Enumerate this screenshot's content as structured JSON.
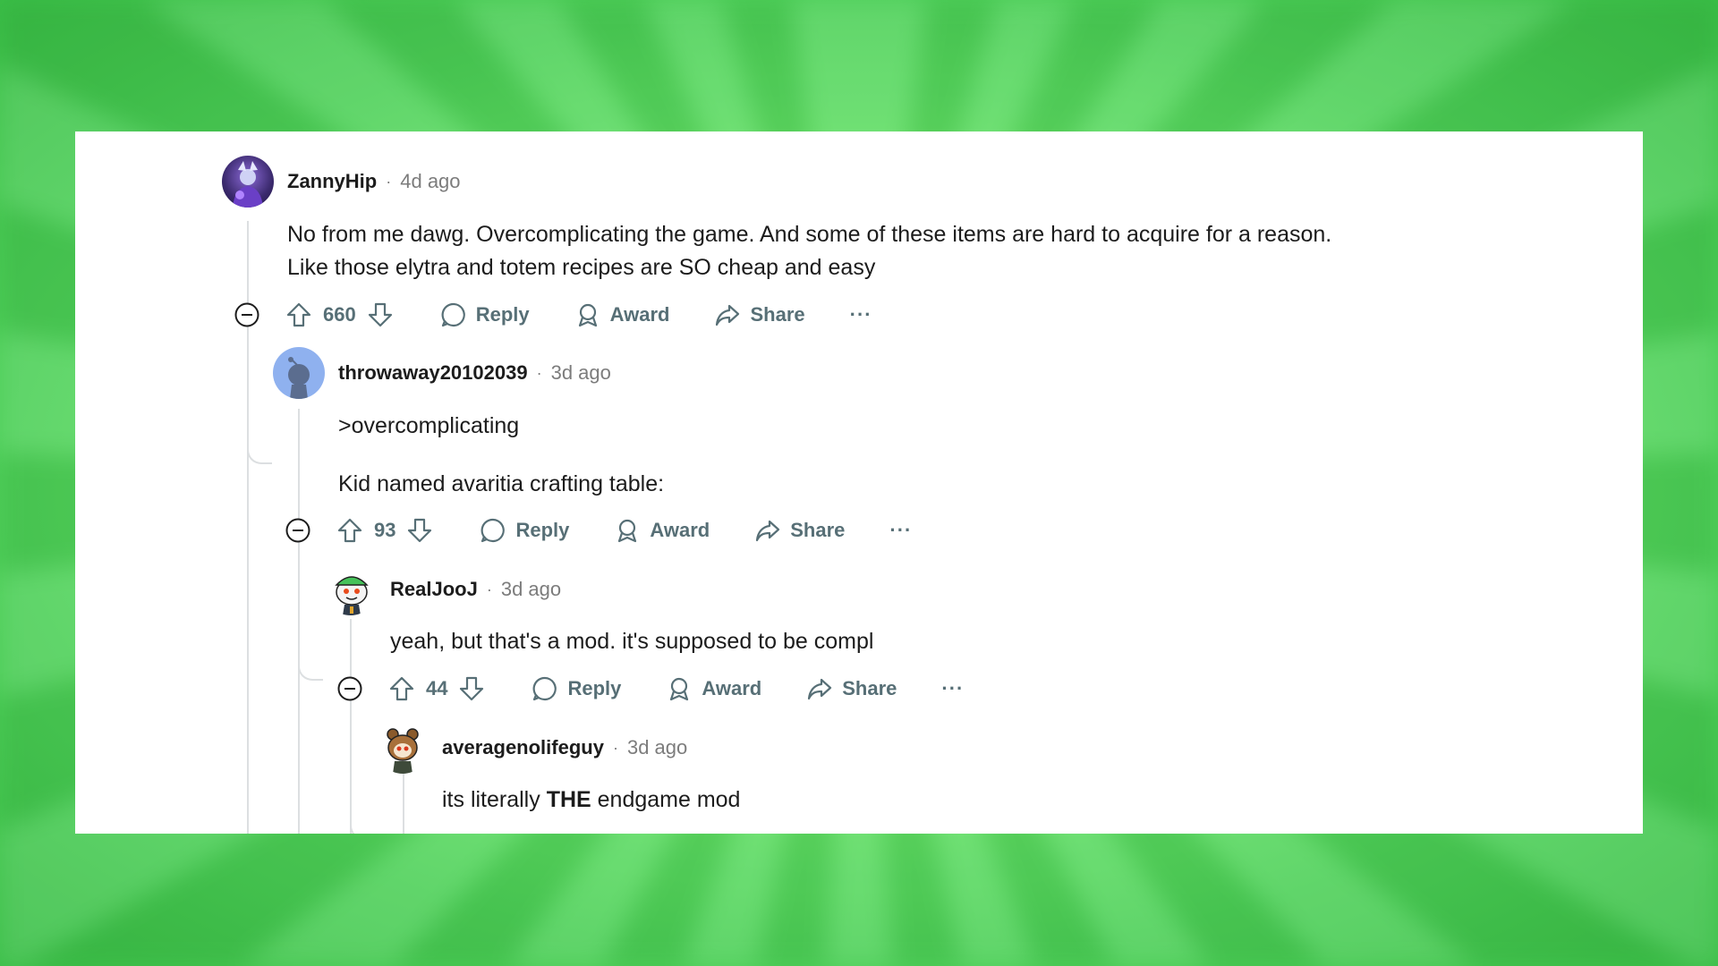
{
  "comments": [
    {
      "username": "ZannyHip",
      "time": "4d ago",
      "lines": [
        "No from me dawg. Overcomplicating the game. And some of these items are hard to acquire for a reason.",
        "Like those elytra and totem recipes are SO cheap and easy"
      ],
      "votes": "660"
    },
    {
      "username": "throwaway20102039",
      "time": "3d ago",
      "lines": [
        ">overcomplicating",
        "Kid named avaritia crafting table:"
      ],
      "votes": "93"
    },
    {
      "username": "RealJooJ",
      "time": "3d ago",
      "lines": [
        "yeah, but that's a mod. it's supposed to be compl"
      ],
      "votes": "44"
    },
    {
      "username": "averagenolifeguy",
      "time": "3d ago",
      "line_before": "its literally ",
      "line_bold": "THE",
      "line_after": " endgame mod"
    }
  ],
  "actions": {
    "reply": "Reply",
    "award": "Award",
    "share": "Share",
    "more": "···"
  },
  "separator": "·",
  "colors": {
    "background": "#6ee86e",
    "card": "#ffffff",
    "text": "#1c1c1c",
    "meta": "#7c7c7c",
    "action": "#576f76",
    "thread_line": "#dcdfe1"
  }
}
